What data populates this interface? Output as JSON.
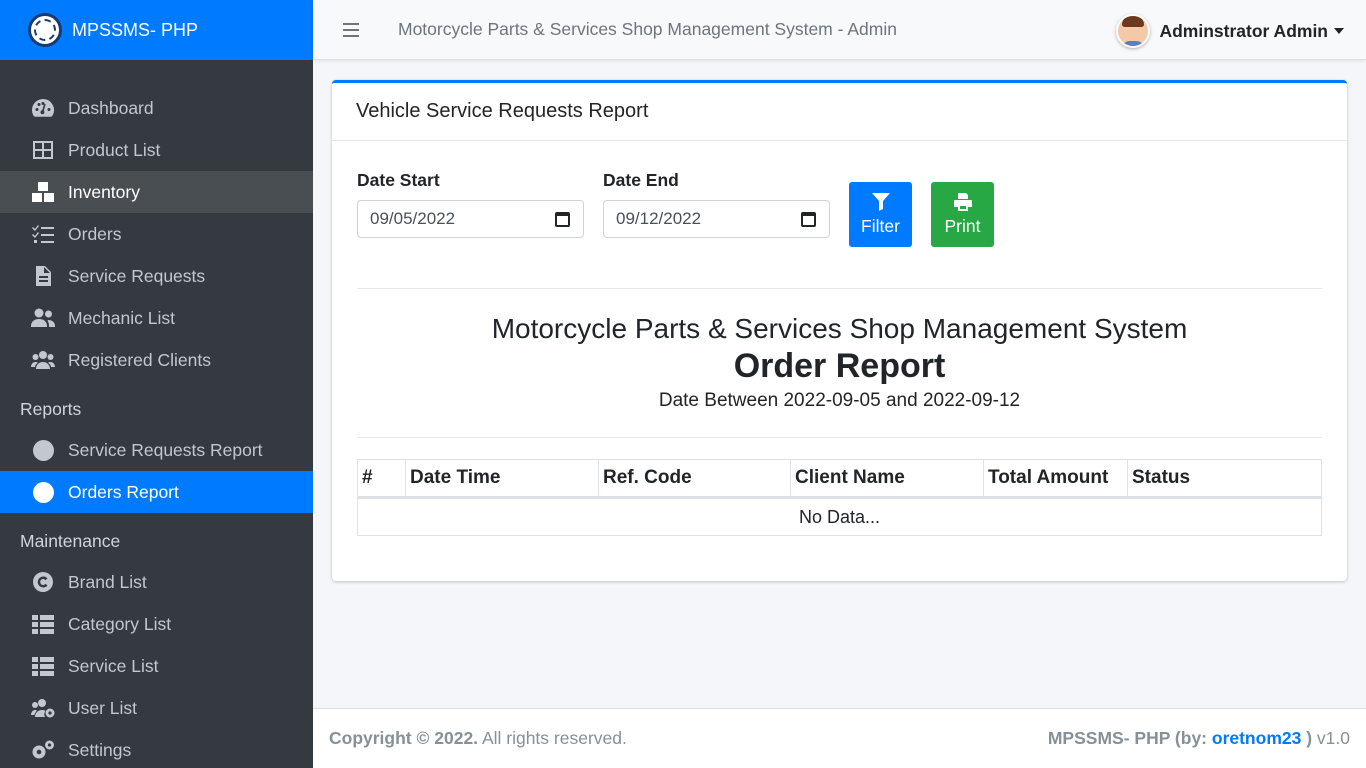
{
  "brand": {
    "name": "MPSSMS- PHP"
  },
  "topbar": {
    "title": "Motorcycle Parts & Services Shop Management System - Admin",
    "user_name": "Adminstrator Admin"
  },
  "sidebar": {
    "items": [
      {
        "label": "Dashboard",
        "icon": "tachometer-icon"
      },
      {
        "label": "Product List",
        "icon": "th-large-icon"
      },
      {
        "label": "Inventory",
        "icon": "boxes-icon"
      },
      {
        "label": "Orders",
        "icon": "tasks-icon"
      },
      {
        "label": "Service Requests",
        "icon": "file-alt-icon"
      },
      {
        "label": "Mechanic List",
        "icon": "user-friends-icon"
      },
      {
        "label": "Registered Clients",
        "icon": "users-icon"
      }
    ],
    "reports_header": "Reports",
    "reports": [
      {
        "label": "Service Requests Report",
        "icon": "circle-icon"
      },
      {
        "label": "Orders Report",
        "icon": "circle-icon"
      }
    ],
    "maintenance_header": "Maintenance",
    "maintenance": [
      {
        "label": "Brand List",
        "icon": "copyright-icon"
      },
      {
        "label": "Category List",
        "icon": "th-list-icon"
      },
      {
        "label": "Service List",
        "icon": "th-list-icon"
      },
      {
        "label": "User List",
        "icon": "users-cog-icon"
      },
      {
        "label": "Settings",
        "icon": "cogs-icon"
      }
    ]
  },
  "card": {
    "title": "Vehicle Service Requests Report",
    "date_start_label": "Date Start",
    "date_start_value": "09/05/2022",
    "date_end_label": "Date End",
    "date_end_value": "09/12/2022",
    "filter_label": "Filter",
    "print_label": "Print"
  },
  "report": {
    "system_name": "Motorcycle Parts & Services Shop Management System",
    "title": "Order Report",
    "range": "Date Between 2022-09-05 and 2022-09-12"
  },
  "table": {
    "headers": [
      "#",
      "Date Time",
      "Ref. Code",
      "Client Name",
      "Total Amount",
      "Status"
    ],
    "empty_text": "No Data..."
  },
  "footer": {
    "copyright": "Copyright © 2022.",
    "rights": " All rights reserved.",
    "app_prefix": "MPSSMS- PHP (by: ",
    "author": "oretnom23",
    "app_suffix": " )",
    "version": " v1.0"
  },
  "colors": {
    "primary": "#007bff",
    "success": "#28a745",
    "sidebar": "#343a40"
  }
}
